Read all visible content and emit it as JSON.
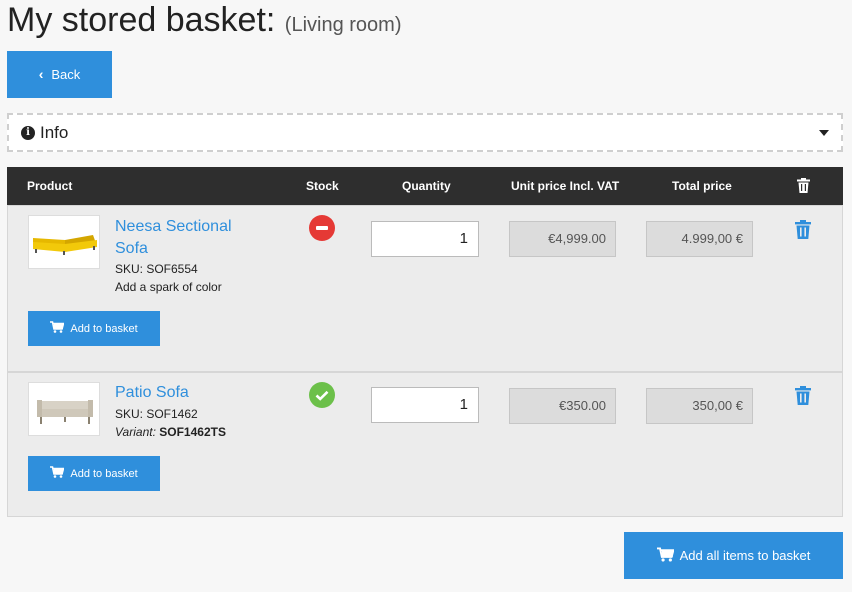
{
  "page": {
    "title": "My stored basket:",
    "subtitle": "(Living room)"
  },
  "back_button": {
    "label": "Back"
  },
  "info_bar": {
    "label": "Info"
  },
  "table": {
    "headers": {
      "product": "Product",
      "stock": "Stock",
      "quantity": "Quantity",
      "unit_price": "Unit price Incl. VAT",
      "total_price": "Total price"
    },
    "rows": [
      {
        "name": "Neesa Sectional Sofa",
        "sku": "SKU: SOF6554",
        "description": "Add a spark of color",
        "stock_status": "out-of-stock",
        "quantity": "1",
        "unit_price": "€4,999.00",
        "total_price": "4.999,00 €",
        "add_label": "Add to basket",
        "image_color": "#e6b800"
      },
      {
        "name": "Patio Sofa",
        "sku": "SKU: SOF1462",
        "variant_label": "Variant:",
        "variant_value": "SOF1462TS",
        "stock_status": "in-stock",
        "quantity": "1",
        "unit_price": "€350.00",
        "total_price": "350,00 €",
        "add_label": "Add to basket",
        "image_color": "#d8d2c6"
      }
    ]
  },
  "add_all_button": {
    "label": "Add all items to basket"
  },
  "colors": {
    "accent": "#2f8fdc",
    "header_bg": "#2e2e2e",
    "out_of_stock": "#e53935",
    "in_stock": "#6cc04a"
  }
}
